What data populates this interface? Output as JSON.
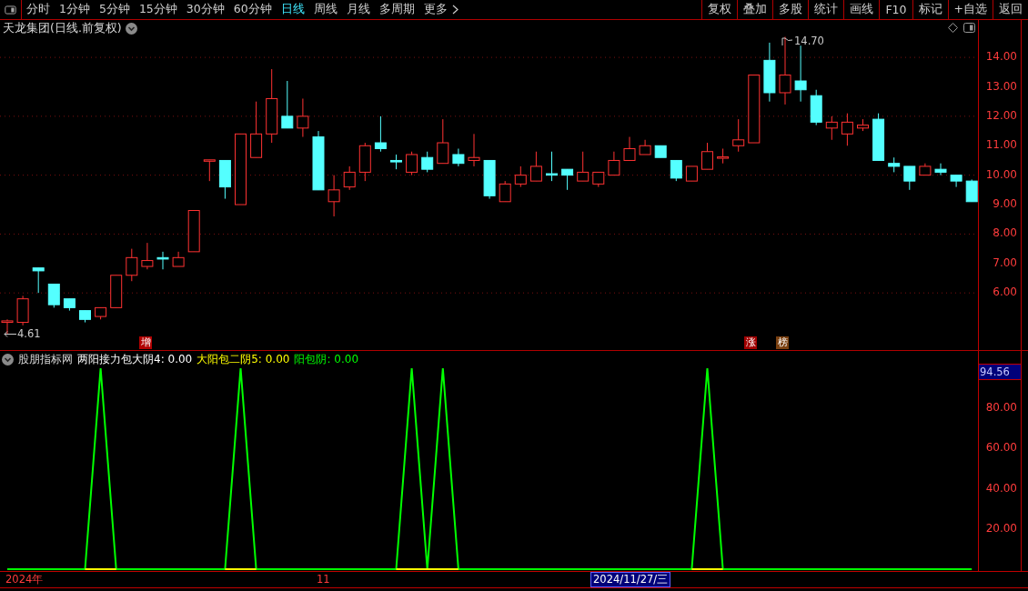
{
  "toolbar": {
    "periods": [
      {
        "label": "分时",
        "selected": false
      },
      {
        "label": "1分钟",
        "selected": false
      },
      {
        "label": "5分钟",
        "selected": false
      },
      {
        "label": "15分钟",
        "selected": false
      },
      {
        "label": "30分钟",
        "selected": false
      },
      {
        "label": "60分钟",
        "selected": false
      },
      {
        "label": "日线",
        "selected": true
      },
      {
        "label": "周线",
        "selected": false
      },
      {
        "label": "月线",
        "selected": false
      },
      {
        "label": "多周期",
        "selected": false
      },
      {
        "label": "更多",
        "selected": false
      }
    ],
    "actions": [
      "复权",
      "叠加",
      "多股",
      "统计",
      "画线",
      "F10",
      "标记",
      "+自选",
      "返回"
    ]
  },
  "main_chart": {
    "title": "天龙集团(日线.前复权)",
    "high_label": "14.70",
    "low_label": "4.61",
    "markers": [
      {
        "text": "增",
        "color": "#b00000"
      },
      {
        "text": "涨",
        "color": "#a00000"
      },
      {
        "text": "榜",
        "color": "#7a4010"
      }
    ],
    "chart_data": {
      "type": "candlestick",
      "ylim": [
        4.06,
        15.27
      ],
      "grid": true,
      "yticks": [
        {
          "value": 14,
          "label": "14.00"
        },
        {
          "value": 13,
          "label": "13.00"
        },
        {
          "value": 12,
          "label": "12.00"
        },
        {
          "value": 11,
          "label": "11.00"
        },
        {
          "value": 10,
          "label": "10.00"
        },
        {
          "value": 9,
          "label": "9.00"
        },
        {
          "value": 8,
          "label": "8.00"
        },
        {
          "value": 7,
          "label": "7.00"
        },
        {
          "value": 6,
          "label": "6.00"
        }
      ],
      "ohlc": [
        [
          5.0,
          5.1,
          4.61,
          5.05
        ],
        [
          5.0,
          5.9,
          4.9,
          5.8
        ],
        [
          6.85,
          6.85,
          6.0,
          6.75
        ],
        [
          6.3,
          6.3,
          5.5,
          5.6
        ],
        [
          5.8,
          5.8,
          5.4,
          5.5
        ],
        [
          5.4,
          5.4,
          5.0,
          5.1
        ],
        [
          5.2,
          5.5,
          5.1,
          5.5
        ],
        [
          5.5,
          6.6,
          5.5,
          6.6
        ],
        [
          6.6,
          7.5,
          6.4,
          7.2
        ],
        [
          6.9,
          7.7,
          6.8,
          7.1
        ],
        [
          7.2,
          7.4,
          6.8,
          7.15
        ],
        [
          6.9,
          7.4,
          6.9,
          7.2
        ],
        [
          7.4,
          8.8,
          7.4,
          8.8
        ],
        [
          10.48,
          10.52,
          9.8,
          10.52
        ],
        [
          10.5,
          10.5,
          9.2,
          9.6
        ],
        [
          9.0,
          11.4,
          9.0,
          11.4
        ],
        [
          10.6,
          12.5,
          10.6,
          11.4
        ],
        [
          11.4,
          13.6,
          11.1,
          12.6
        ],
        [
          12.0,
          13.2,
          11.6,
          11.6
        ],
        [
          11.6,
          12.6,
          11.3,
          12.0
        ],
        [
          11.3,
          11.5,
          9.5,
          9.5
        ],
        [
          9.1,
          10.0,
          8.6,
          9.5
        ],
        [
          9.6,
          10.3,
          9.5,
          10.1
        ],
        [
          10.1,
          11.1,
          9.8,
          11.0
        ],
        [
          11.1,
          12.0,
          10.8,
          10.9
        ],
        [
          10.5,
          10.7,
          10.2,
          10.45
        ],
        [
          10.1,
          10.8,
          10.0,
          10.7
        ],
        [
          10.6,
          10.8,
          10.1,
          10.2
        ],
        [
          10.4,
          11.9,
          10.4,
          11.1
        ],
        [
          10.7,
          10.9,
          10.3,
          10.4
        ],
        [
          10.5,
          11.4,
          10.3,
          10.6
        ],
        [
          10.5,
          10.5,
          9.2,
          9.3
        ],
        [
          9.1,
          9.8,
          9.1,
          9.7
        ],
        [
          9.7,
          10.3,
          9.6,
          10.0
        ],
        [
          9.8,
          10.8,
          9.8,
          10.3
        ],
        [
          10.05,
          10.8,
          9.8,
          10.0
        ],
        [
          10.2,
          10.2,
          9.5,
          10.0
        ],
        [
          9.8,
          10.8,
          9.8,
          10.1
        ],
        [
          9.7,
          10.1,
          9.6,
          10.1
        ],
        [
          10.0,
          10.8,
          10.0,
          10.5
        ],
        [
          10.5,
          11.3,
          10.5,
          10.9
        ],
        [
          10.7,
          11.2,
          10.7,
          11.0
        ],
        [
          11.0,
          11.0,
          10.6,
          10.6
        ],
        [
          10.5,
          10.5,
          9.8,
          9.9
        ],
        [
          9.8,
          10.3,
          9.8,
          10.3
        ],
        [
          10.2,
          11.1,
          10.2,
          10.8
        ],
        [
          10.58,
          10.9,
          10.4,
          10.62
        ],
        [
          11.0,
          11.9,
          10.8,
          11.2
        ],
        [
          11.1,
          13.4,
          11.1,
          13.4
        ],
        [
          13.9,
          14.5,
          12.5,
          12.8
        ],
        [
          12.8,
          14.7,
          12.4,
          13.4
        ],
        [
          13.2,
          14.4,
          12.5,
          12.9
        ],
        [
          12.7,
          12.9,
          11.7,
          11.8
        ],
        [
          11.6,
          12.0,
          11.2,
          11.8
        ],
        [
          11.4,
          12.1,
          11.0,
          11.8
        ],
        [
          11.6,
          11.9,
          11.5,
          11.7
        ],
        [
          11.9,
          12.1,
          10.5,
          10.5
        ],
        [
          10.4,
          10.6,
          10.1,
          10.3
        ],
        [
          10.3,
          10.3,
          9.5,
          9.8
        ],
        [
          10.0,
          10.4,
          10.0,
          10.3
        ],
        [
          10.2,
          10.4,
          10.0,
          10.1
        ],
        [
          10.0,
          10.0,
          9.6,
          9.8
        ],
        [
          9.8,
          9.85,
          9.1,
          9.1
        ]
      ]
    }
  },
  "indicator": {
    "name": "股朋指标网",
    "cursor_value": "94.56",
    "legend": [
      {
        "name": "两阳接力包大阴4",
        "value": ": 0.00",
        "color": "#ffffff"
      },
      {
        "value": ": 0.00"
      },
      {
        "value": ": 0.00"
      }
    ],
    "chart_data": {
      "type": "line",
      "ylim": [
        -0.9,
        108.6
      ],
      "yticks": [
        {
          "value": 20,
          "label": "20.00"
        },
        {
          "value": 40,
          "label": "40.00"
        },
        {
          "value": 60,
          "label": "60.00"
        },
        {
          "value": 80,
          "label": "80.00"
        }
      ],
      "series": [
        {
          "name": "大阳包二阴5",
          "color": "#ffff00",
          "values": [
            null,
            null,
            null,
            null,
            null,
            0,
            0,
            0,
            null,
            null,
            null,
            null,
            null,
            null,
            0,
            0,
            0,
            null,
            null,
            null,
            null,
            null,
            null,
            null,
            null,
            0,
            0,
            0,
            0,
            0,
            null,
            null,
            null,
            null,
            null,
            null,
            null,
            null,
            null,
            null,
            null,
            null,
            null,
            null,
            0,
            0,
            0,
            null,
            null,
            null,
            null,
            null,
            null,
            null,
            null,
            null,
            null,
            null,
            null,
            null,
            null,
            null,
            null
          ]
        },
        {
          "name": "阳包阴",
          "color": "#00ff00",
          "values": [
            0,
            0,
            0,
            0,
            0,
            0,
            100,
            0,
            0,
            0,
            0,
            0,
            0,
            0,
            0,
            100,
            0,
            0,
            0,
            0,
            0,
            0,
            0,
            0,
            0,
            0,
            100,
            0,
            100,
            0,
            0,
            0,
            0,
            0,
            0,
            0,
            0,
            0,
            0,
            0,
            0,
            0,
            0,
            0,
            0,
            100,
            0,
            0,
            0,
            0,
            0,
            0,
            0,
            0,
            0,
            0,
            0,
            0,
            0,
            0,
            0,
            0,
            0
          ]
        }
      ]
    }
  },
  "x_axis": {
    "labels": [
      {
        "text": "2024年",
        "selected": false
      },
      {
        "text": "11",
        "selected": false
      },
      {
        "text": "2024/11/27/三",
        "selected": true
      }
    ]
  }
}
